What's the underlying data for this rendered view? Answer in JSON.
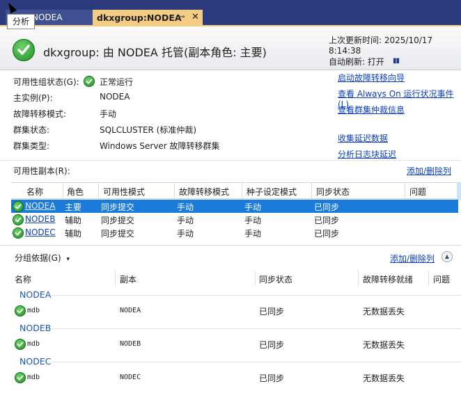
{
  "tabs": {
    "tab1": "NODEA",
    "tab2": "dkxgroup:NODEA",
    "tab2_pin": "⊸",
    "tab2_close": "✕",
    "tooltip": "分析"
  },
  "header": {
    "title": "dkxgroup: 由 NODEA 托管(副本角色: 主要)",
    "last_updated": "上次更新时间: 2025/10/17 8:14:38",
    "auto_refresh": "自动刷新: 打开",
    "pause_icon_text": "▮▮"
  },
  "info": {
    "rows": [
      {
        "label": "可用性组状态(G):",
        "value": "正常运行",
        "icon": "check-icon"
      },
      {
        "label": "主实例(P):",
        "value": "NODEA"
      },
      {
        "label": "故障转移模式:",
        "value": "手动"
      },
      {
        "label": "群集状态:",
        "value": "SQLCLUSTER (标准仲裁)"
      },
      {
        "label": "群集类型:",
        "value": "Windows Server 故障转移群集"
      }
    ]
  },
  "links": {
    "wizard": "启动故障转移向导",
    "events": "查看 Always On 运行状况事件(L)",
    "quorum": "查看群集仲裁信息",
    "latency": "收集延迟数据",
    "logblock": "分析日志块延迟"
  },
  "replicas": {
    "section_label": "可用性副本(R):",
    "add_remove": "添加/删除列",
    "columns": [
      "名称",
      "角色",
      "可用性模式",
      "故障转移模式",
      "种子设定模式",
      "同步状态",
      "问题"
    ],
    "rows": [
      {
        "name": "NODEA",
        "role": "主要",
        "mode": "同步提交",
        "failover": "手动",
        "seeding": "手动",
        "sync": "已同步",
        "issues": ""
      },
      {
        "name": "NODEB",
        "role": "辅助",
        "mode": "同步提交",
        "failover": "手动",
        "seeding": "手动",
        "sync": "已同步",
        "issues": ""
      },
      {
        "name": "NODEC",
        "role": "辅助",
        "mode": "同步提交",
        "failover": "手动",
        "seeding": "手动",
        "sync": "已同步",
        "issues": ""
      }
    ]
  },
  "databases": {
    "group_by": "分组依据(G)",
    "group_by_arrow": "▾",
    "add_remove": "添加/删除列",
    "collapse_icon": "▲",
    "columns": [
      "名称",
      "副本",
      "同步状态",
      "故障转移就绪",
      "问题"
    ],
    "groups": [
      {
        "name": "NODEA",
        "db": "mdb",
        "replica": "NODEA",
        "sync": "已同步",
        "ready": "无数据丢失"
      },
      {
        "name": "NODEB",
        "db": "mdb",
        "replica": "NODEB",
        "sync": "已同步",
        "ready": "无数据丢失"
      },
      {
        "name": "NODEC",
        "db": "mdb",
        "replica": "NODEC",
        "sync": "已同步",
        "ready": "无数据丢失"
      }
    ]
  },
  "colors": {
    "tabbar": "#2b3a7a",
    "active_tab": "#f5cc84",
    "selection": "#1a7cd8",
    "link": "#0b3fbd",
    "group_header": "#1a56b8",
    "check_green": "#1f8f26"
  }
}
